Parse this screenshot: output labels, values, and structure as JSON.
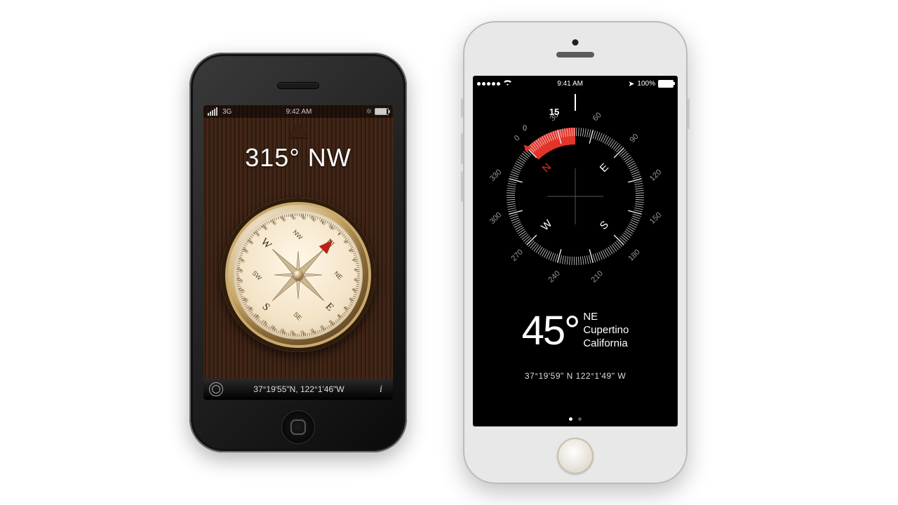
{
  "left": {
    "statusbar": {
      "carrier": "3G",
      "time": "9:42 AM"
    },
    "heading": "315° NW",
    "coords": "37°19'55\"N, 122°1'46\"W",
    "compass_angle": 315,
    "cardinals": [
      "N",
      "E",
      "S",
      "W"
    ],
    "intercardinals": [
      "NE",
      "SE",
      "SW",
      "NW"
    ],
    "ticks_deg": [
      0,
      10,
      20,
      30,
      40,
      50,
      60,
      70,
      80,
      90,
      100,
      110,
      120,
      130,
      140,
      150,
      160,
      170,
      180,
      190,
      200,
      210,
      220,
      230,
      240,
      250,
      260,
      270,
      280,
      290,
      300,
      310,
      320,
      330,
      340,
      350
    ]
  },
  "right": {
    "statusbar": {
      "time": "9:41 AM",
      "battery_text": "100%"
    },
    "heading_deg": "45",
    "heading_dir": "NE",
    "city": "Cupertino",
    "region": "California",
    "coords": "37°19'59\" N  122°1'49\" W",
    "dial_angle": 45,
    "cardinals": [
      "N",
      "E",
      "S",
      "W"
    ],
    "outer_labels": [
      0,
      30,
      60,
      90,
      120,
      150,
      180,
      210,
      240,
      270,
      300,
      330
    ],
    "label_top_left": "15",
    "label_top_left2": "0"
  }
}
